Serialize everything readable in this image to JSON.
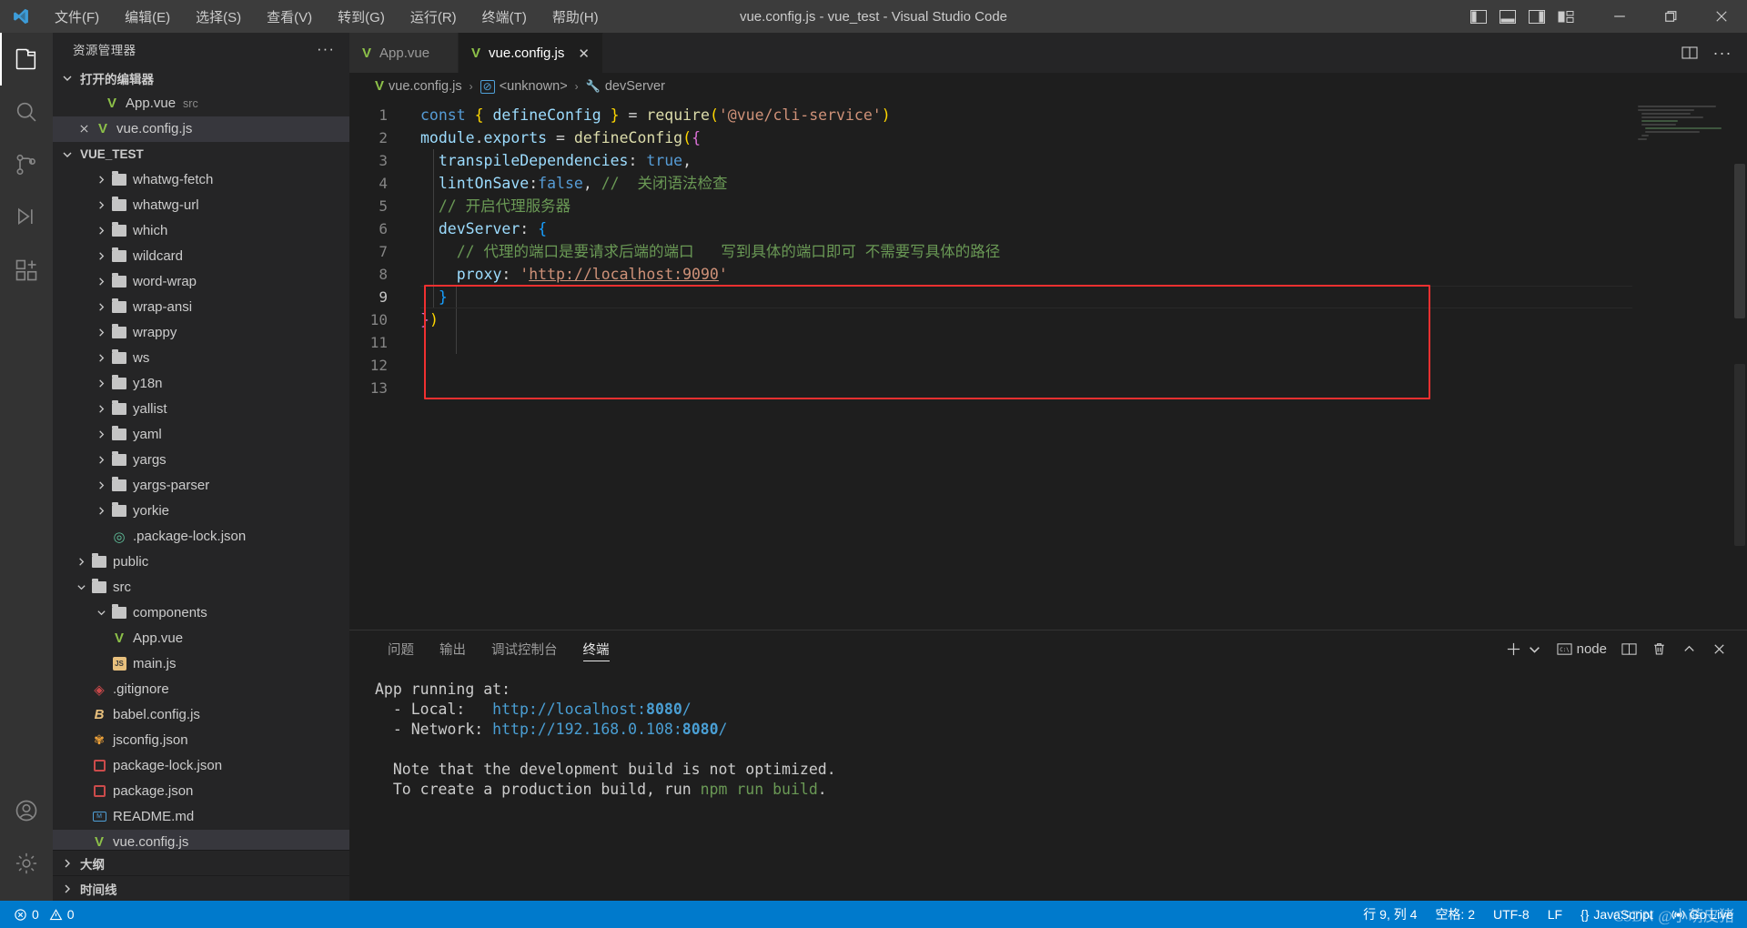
{
  "titlebar": {
    "logo_icon": "vscode-logo",
    "window_title": "vue.config.js - vue_test - Visual Studio Code",
    "menus": [
      {
        "label": "文件(F)"
      },
      {
        "label": "编辑(E)"
      },
      {
        "label": "选择(S)"
      },
      {
        "label": "查看(V)"
      },
      {
        "label": "转到(G)"
      },
      {
        "label": "运行(R)"
      },
      {
        "label": "终端(T)"
      },
      {
        "label": "帮助(H)"
      }
    ],
    "layout_icons": [
      "toggle-primary-sidebar-icon",
      "toggle-panel-icon",
      "toggle-secondary-sidebar-icon",
      "customize-layout-icon"
    ],
    "window_controls": [
      "minimize-icon",
      "maximize-icon",
      "close-icon"
    ]
  },
  "activitybar": {
    "items": [
      {
        "name": "explorer",
        "icon": "files-icon",
        "active": true
      },
      {
        "name": "search",
        "icon": "search-icon",
        "active": false
      },
      {
        "name": "source-control",
        "icon": "source-control-icon",
        "active": false
      },
      {
        "name": "run-debug",
        "icon": "run-debug-icon",
        "active": false
      },
      {
        "name": "extensions",
        "icon": "extensions-icon",
        "active": false
      }
    ],
    "bottom_items": [
      {
        "name": "accounts",
        "icon": "account-icon"
      },
      {
        "name": "settings",
        "icon": "gear-icon"
      }
    ]
  },
  "sidebar": {
    "title": "资源管理器",
    "more_actions": "···",
    "open_editors": {
      "label": "打开的编辑器",
      "items": [
        {
          "label": "App.vue",
          "sub": "src",
          "icon": "vue-icon",
          "selected": false,
          "closable": false
        },
        {
          "label": "vue.config.js",
          "sub": "",
          "icon": "vue-icon",
          "selected": true,
          "closable": true
        }
      ]
    },
    "workspace": {
      "label": "VUE_TEST",
      "items": [
        {
          "label": "whatwg-fetch",
          "icon": "folder-icon",
          "type": "folder",
          "indent": 1
        },
        {
          "label": "whatwg-url",
          "icon": "folder-icon",
          "type": "folder",
          "indent": 1
        },
        {
          "label": "which",
          "icon": "folder-icon",
          "type": "folder",
          "indent": 1
        },
        {
          "label": "wildcard",
          "icon": "folder-icon",
          "type": "folder",
          "indent": 1
        },
        {
          "label": "word-wrap",
          "icon": "folder-icon",
          "type": "folder",
          "indent": 1
        },
        {
          "label": "wrap-ansi",
          "icon": "folder-icon",
          "type": "folder",
          "indent": 1
        },
        {
          "label": "wrappy",
          "icon": "folder-icon",
          "type": "folder",
          "indent": 1
        },
        {
          "label": "ws",
          "icon": "folder-icon",
          "type": "folder",
          "indent": 1
        },
        {
          "label": "y18n",
          "icon": "folder-icon",
          "type": "folder",
          "indent": 1
        },
        {
          "label": "yallist",
          "icon": "folder-icon",
          "type": "folder",
          "indent": 1
        },
        {
          "label": "yaml",
          "icon": "folder-icon",
          "type": "folder",
          "indent": 1
        },
        {
          "label": "yargs",
          "icon": "folder-icon",
          "type": "folder",
          "indent": 1
        },
        {
          "label": "yargs-parser",
          "icon": "folder-icon",
          "type": "folder",
          "indent": 1
        },
        {
          "label": "yorkie",
          "icon": "folder-icon",
          "type": "folder",
          "indent": 1
        },
        {
          "label": ".package-lock.json",
          "icon": "json-icon",
          "type": "file",
          "indent": 1
        },
        {
          "label": "public",
          "icon": "folder-icon",
          "type": "folder",
          "indent": 0
        },
        {
          "label": "src",
          "icon": "folder-icon",
          "type": "folder-open",
          "indent": 0
        },
        {
          "label": "components",
          "icon": "folder-icon",
          "type": "folder-open",
          "indent": 1
        },
        {
          "label": "App.vue",
          "icon": "vue-icon",
          "type": "file",
          "indent": 1
        },
        {
          "label": "main.js",
          "icon": "js-icon",
          "type": "file",
          "indent": 1
        },
        {
          "label": ".gitignore",
          "icon": "git-icon",
          "type": "file",
          "indent": 0
        },
        {
          "label": "babel.config.js",
          "icon": "babel-icon",
          "type": "file",
          "indent": 0
        },
        {
          "label": "jsconfig.json",
          "icon": "config-icon",
          "type": "file",
          "indent": 0
        },
        {
          "label": "package-lock.json",
          "icon": "package-icon",
          "type": "file",
          "indent": 0
        },
        {
          "label": "package.json",
          "icon": "package-icon",
          "type": "file",
          "indent": 0
        },
        {
          "label": "README.md",
          "icon": "markdown-icon",
          "type": "file",
          "indent": 0
        },
        {
          "label": "vue.config.js",
          "icon": "vue-icon",
          "type": "file",
          "indent": 0,
          "selected": true
        }
      ]
    },
    "outline_label": "大纲",
    "timeline_label": "时间线"
  },
  "editor": {
    "tabs": [
      {
        "label": "App.vue",
        "icon": "vue-icon",
        "active": false,
        "closable": false
      },
      {
        "label": "vue.config.js",
        "icon": "vue-icon",
        "active": true,
        "closable": true,
        "close_glyph": "✕"
      }
    ],
    "tab_actions": [
      "split-editor-icon",
      "more-actions-icon"
    ],
    "breadcrumb": [
      {
        "label": "vue.config.js",
        "icon": "vue-icon"
      },
      {
        "label": "<unknown>",
        "icon": "symbol-object-icon"
      },
      {
        "label": "devServer",
        "icon": "wrench-icon"
      }
    ],
    "breadcrumb_separator": "›",
    "lines": [
      {
        "num": "1",
        "text": "const { defineConfig } = require('@vue/cli-service')"
      },
      {
        "num": "2",
        "text": "module.exports = defineConfig({"
      },
      {
        "num": "3",
        "text": "  transpileDependencies: true,"
      },
      {
        "num": "4",
        "text": "  lintOnSave:false, //  关闭语法检查"
      },
      {
        "num": "5",
        "text": "  // 开启代理服务器"
      },
      {
        "num": "6",
        "text": "  devServer: {"
      },
      {
        "num": "7",
        "text": "    // 代理的端口是要请求后端的端口   写到具体的端口即可 不需要写具体的路径"
      },
      {
        "num": "8",
        "text": "    proxy: 'http://localhost:9090'"
      },
      {
        "num": "9",
        "text": "  }"
      },
      {
        "num": "10",
        "text": "})"
      },
      {
        "num": "11",
        "text": ""
      },
      {
        "num": "12",
        "text": ""
      },
      {
        "num": "13",
        "text": ""
      }
    ],
    "highlight_annotation": "red-rectangle-around-lines-5-to-10"
  },
  "panel": {
    "tabs": [
      {
        "label": "问题",
        "active": false
      },
      {
        "label": "输出",
        "active": false
      },
      {
        "label": "调试控制台",
        "active": false
      },
      {
        "label": "终端",
        "active": true
      }
    ],
    "actions": {
      "new_terminal_label": "",
      "terminal_name": "node",
      "icons": [
        "add-icon",
        "chevron-down-icon",
        "terminal-node-icon",
        "split-terminal-icon",
        "kill-terminal-icon",
        "maximize-panel-icon",
        "close-panel-icon"
      ]
    },
    "terminal_lines": [
      {
        "segments": [
          {
            "t": "App running at:",
            "c": "plain"
          }
        ]
      },
      {
        "segments": [
          {
            "t": "  - Local:   ",
            "c": "plain"
          },
          {
            "t": "http://localhost:",
            "c": "link"
          },
          {
            "t": "8080",
            "c": "num"
          },
          {
            "t": "/",
            "c": "link"
          }
        ]
      },
      {
        "segments": [
          {
            "t": "  - Network: ",
            "c": "plain"
          },
          {
            "t": "http://192.168.0.108:",
            "c": "link"
          },
          {
            "t": "8080",
            "c": "num"
          },
          {
            "t": "/",
            "c": "link"
          }
        ]
      },
      {
        "segments": [
          {
            "t": "",
            "c": "plain"
          }
        ]
      },
      {
        "segments": [
          {
            "t": "  Note that the development build is not optimized.",
            "c": "plain"
          }
        ]
      },
      {
        "segments": [
          {
            "t": "  To create a production build, run ",
            "c": "plain"
          },
          {
            "t": "npm run build",
            "c": "cmd"
          },
          {
            "t": ".",
            "c": "plain"
          }
        ]
      }
    ]
  },
  "statusbar": {
    "errors": "0",
    "warnings": "0",
    "cursor_position": "行 9, 列 4",
    "indentation": "空格: 2",
    "encoding": "UTF-8",
    "eol": "LF",
    "language": "JavaScript",
    "go_live": "Go Live",
    "watermark": "CSDN @小萌皮猪",
    "accent_color": "#007acc"
  }
}
